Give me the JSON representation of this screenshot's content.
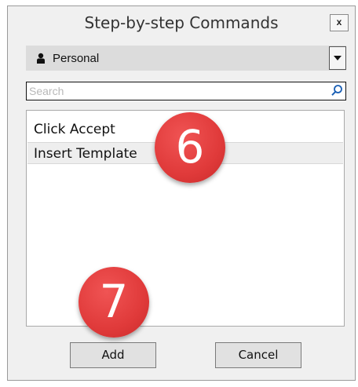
{
  "window": {
    "title": "Step-by-step Commands",
    "close_label": "x"
  },
  "profile": {
    "selected": "Personal",
    "icon": "person-icon"
  },
  "search": {
    "placeholder": "Search",
    "value": "",
    "icon": "search-icon"
  },
  "commands": {
    "items": [
      {
        "label": "Click Accept",
        "selected": false
      },
      {
        "label": "Insert Template",
        "selected": true
      }
    ]
  },
  "buttons": {
    "add_label": "Add",
    "cancel_label": "Cancel"
  },
  "annotations": [
    {
      "label": "6"
    },
    {
      "label": "7"
    }
  ],
  "colors": {
    "badge": "#e03a3a",
    "dialog_bg": "#f0f0f0",
    "selected_row": "#eeeeee"
  }
}
